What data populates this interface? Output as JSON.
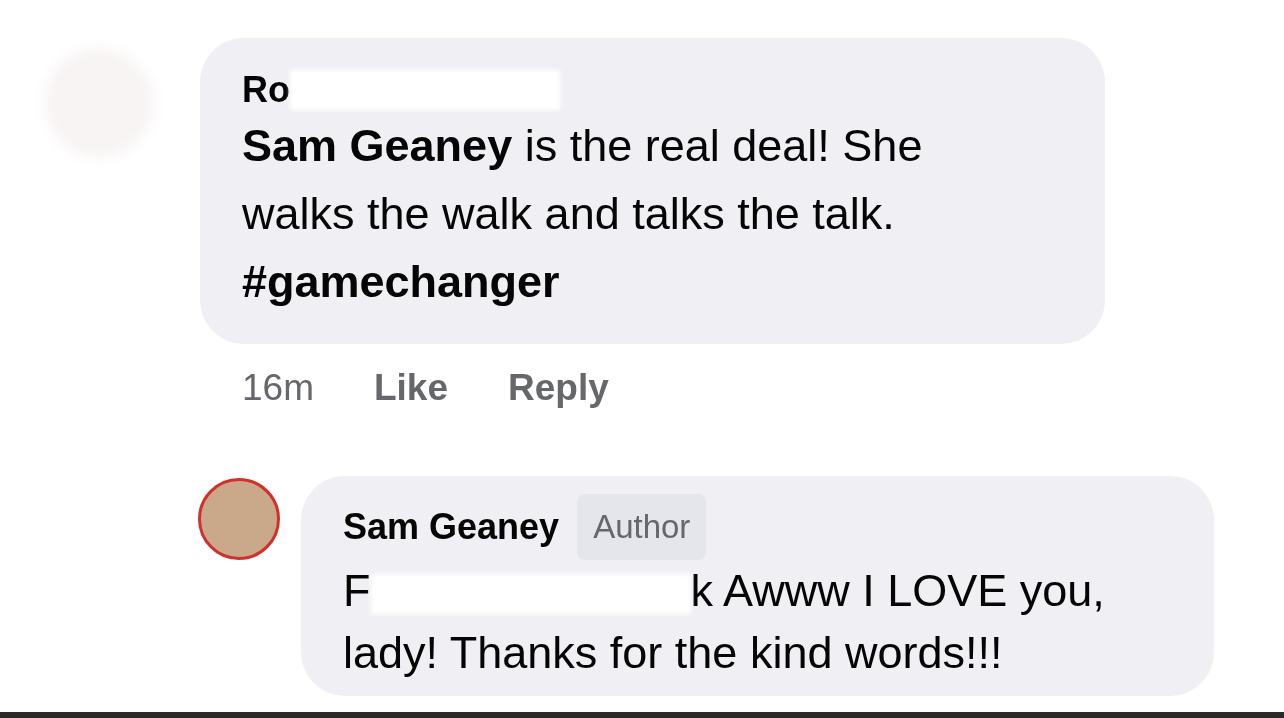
{
  "comments": [
    {
      "name": "Ro",
      "name_redacted": true,
      "author": false,
      "text_redacted": false,
      "text": "**Sam Geaney** is the real deal! She walks the walk and talks the talk. **#gamechanger**",
      "time": "16m",
      "actions": [
        "Like",
        "Reply"
      ]
    },
    {
      "name": "Sam Geaney",
      "name_redacted": false,
      "author": true,
      "badge": "Author",
      "text_redacted": true,
      "text_start": "F",
      "text": "k Awww I LOVE you, lady! Thanks for the kind words!!!"
    }
  ]
}
